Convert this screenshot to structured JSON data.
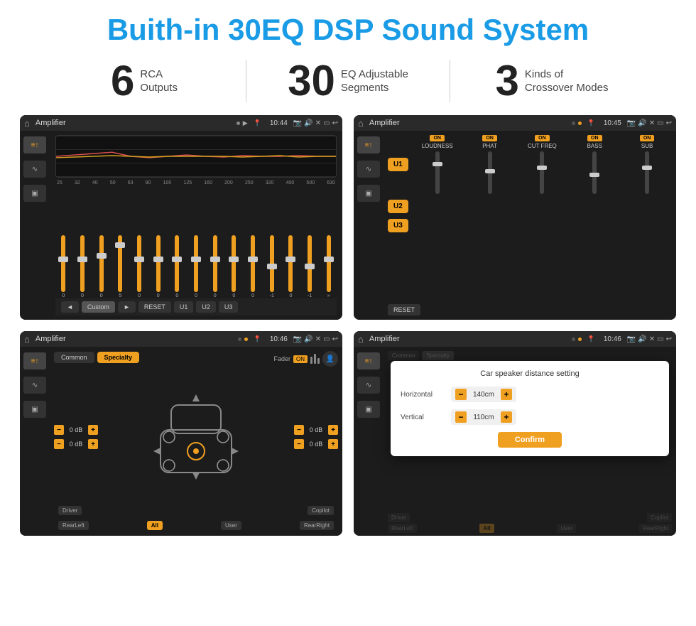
{
  "header": {
    "title": "Buith-in 30EQ DSP Sound System"
  },
  "stats": [
    {
      "number": "6",
      "text_line1": "RCA",
      "text_line2": "Outputs"
    },
    {
      "number": "30",
      "text_line1": "EQ Adjustable",
      "text_line2": "Segments"
    },
    {
      "number": "3",
      "text_line1": "Kinds of",
      "text_line2": "Crossover Modes"
    }
  ],
  "screens": [
    {
      "id": "screen1",
      "app_name": "Amplifier",
      "time": "10:44",
      "eq_labels": [
        "25",
        "32",
        "40",
        "50",
        "63",
        "80",
        "100",
        "125",
        "160",
        "200",
        "250",
        "320",
        "400",
        "500",
        "630"
      ],
      "eq_values": [
        "0",
        "0",
        "0",
        "5",
        "0",
        "0",
        "0",
        "0",
        "0",
        "0",
        "0",
        "-1",
        "0",
        "-1"
      ],
      "bottom_buttons": [
        "◄",
        "Custom",
        "►",
        "RESET",
        "U1",
        "U2",
        "U3"
      ]
    },
    {
      "id": "screen2",
      "app_name": "Amplifier",
      "time": "10:45",
      "u_buttons": [
        "U1",
        "U2",
        "U3"
      ],
      "modules": [
        "LOUDNESS",
        "PHAT",
        "CUT FREQ",
        "BASS",
        "SUB"
      ],
      "reset_label": "RESET"
    },
    {
      "id": "screen3",
      "app_name": "Amplifier",
      "time": "10:46",
      "tabs": [
        "Common",
        "Specialty"
      ],
      "fader_label": "Fader",
      "fader_on": "ON",
      "db_controls": [
        "0 dB",
        "0 dB",
        "0 dB",
        "0 dB"
      ],
      "bottom_labels": [
        "Driver",
        "",
        "Copilot",
        "RearLeft",
        "All",
        "User",
        "RearRight"
      ]
    },
    {
      "id": "screen4",
      "app_name": "Amplifier",
      "time": "10:46",
      "tabs": [
        "Common",
        "Specialty"
      ],
      "modal": {
        "title": "Car speaker distance setting",
        "rows": [
          {
            "label": "Horizontal",
            "value": "140cm"
          },
          {
            "label": "Vertical",
            "value": "110cm"
          }
        ],
        "confirm_label": "Confirm"
      },
      "bottom_labels": [
        "Driver",
        "",
        "Copilot",
        "RearLeft",
        "All",
        "User",
        "RearRight"
      ]
    }
  ]
}
